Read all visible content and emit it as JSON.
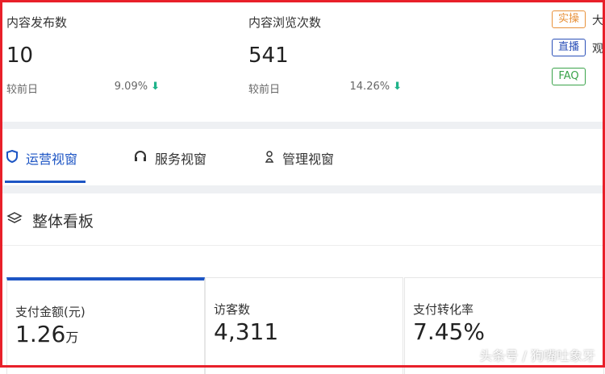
{
  "stats": [
    {
      "label": "内容发布数",
      "value": "10",
      "compare_label": "较前日",
      "change": "9.09%"
    },
    {
      "label": "内容浏览次数",
      "value": "541",
      "compare_label": "较前日",
      "change": "14.26%"
    }
  ],
  "badges": [
    {
      "label": "实操",
      "text": "大",
      "color": "#e8913a"
    },
    {
      "label": "直播",
      "text": "观",
      "color": "#2b50b8"
    },
    {
      "label": "FAQ",
      "text": "",
      "color": "#3aa34a"
    }
  ],
  "tabs": [
    {
      "label": "运营视窗",
      "icon": "shield-icon"
    },
    {
      "label": "服务视窗",
      "icon": "headset-icon"
    },
    {
      "label": "管理视窗",
      "icon": "person-icon"
    }
  ],
  "section": {
    "title": "整体看板",
    "icon": "layers-icon"
  },
  "cards": [
    {
      "label": "支付金额(元)",
      "value": "1.26",
      "unit": "万"
    },
    {
      "label": "访客数",
      "value": "4,311",
      "unit": ""
    },
    {
      "label": "支付转化率",
      "value": "7.45%",
      "unit": ""
    }
  ],
  "watermark": "头条号 / 狗嘴吐象牙",
  "colors": {
    "accent": "#1d55c4",
    "down": "#1fb38a",
    "frame": "#e8202a"
  }
}
